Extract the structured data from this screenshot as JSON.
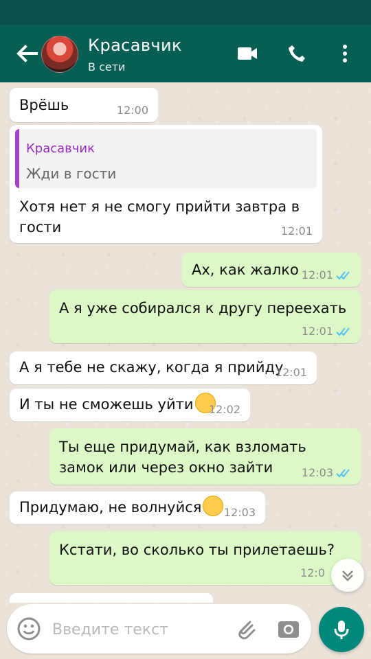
{
  "header": {
    "contact_name": "Красавчик",
    "status": "В сети"
  },
  "messages": [
    {
      "id": "m1",
      "direction": "in",
      "text": "Врёшь",
      "time": "12:00"
    },
    {
      "id": "m2",
      "direction": "in",
      "reply_to": {
        "name": "Красавчик",
        "text": "Жди в гости"
      },
      "text": "Хотя нет я не смогу прийти завтра в гости",
      "time": "12:01"
    },
    {
      "id": "m3",
      "direction": "out",
      "text": "Ах, как жалко",
      "time": "12:01"
    },
    {
      "id": "m4",
      "direction": "out",
      "text": "А я уже собирался к другу переехать",
      "time": "12:01"
    },
    {
      "id": "m5",
      "direction": "in",
      "text": "А я тебе не скажу, когда я прийду",
      "time": "12:01"
    },
    {
      "id": "m6",
      "direction": "in",
      "text": "И ты не сможешь уйти",
      "time": "12:02",
      "emoji": "relieved-face"
    },
    {
      "id": "m7",
      "direction": "out",
      "text": "Ты еще придумай, как взломать замок или через окно зайти",
      "time": "12:03"
    },
    {
      "id": "m8",
      "direction": "in",
      "text": "Придумаю, не волнуйся",
      "time": "12:03",
      "emoji": "winking-face"
    },
    {
      "id": "m9",
      "direction": "out",
      "text": "Кстати, во сколько ты прилетаешь?",
      "time": "12:0"
    }
  ],
  "input": {
    "placeholder": "Введите текст"
  },
  "icons": {
    "back": "arrow-left-icon",
    "video": "video-call-icon",
    "call": "phone-icon",
    "more": "more-vertical-icon",
    "emoji": "emoji-icon",
    "attach": "paperclip-icon",
    "camera": "camera-icon",
    "mic": "mic-icon",
    "scroll": "chevron-down-double-icon"
  },
  "colors": {
    "header": "#075e54",
    "status_bar": "#0b4f4a",
    "incoming": "#ffffff",
    "outgoing": "#dcf8c6",
    "read_ticks": "#4fc3f7",
    "quote_accent": "#9a2bc3",
    "mic_button": "#00897b"
  }
}
